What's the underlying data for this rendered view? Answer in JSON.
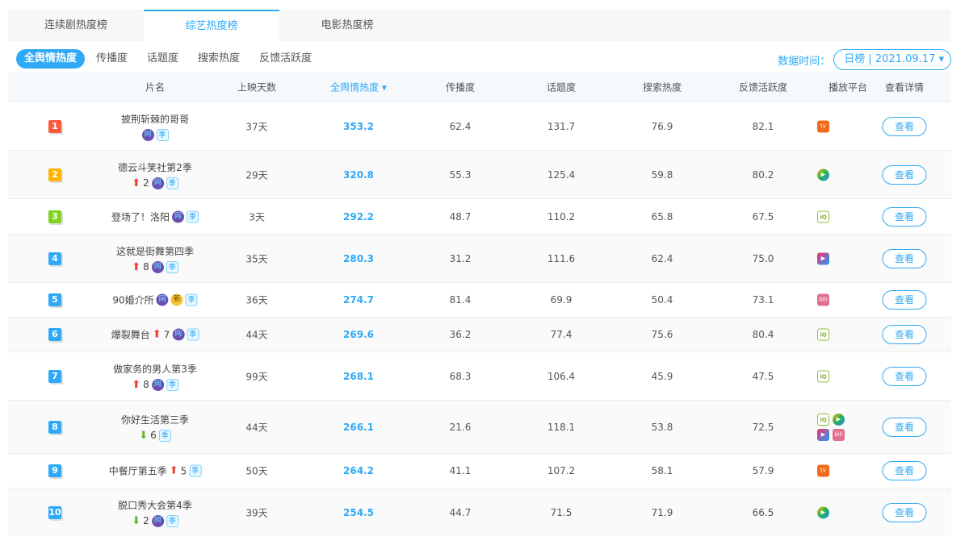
{
  "tabs": [
    "连续剧热度榜",
    "综艺热度榜",
    "电影热度榜"
  ],
  "subtabs": [
    "全舆情热度",
    "传播度",
    "话题度",
    "搜索热度",
    "反馈活跃度"
  ],
  "date_label": "数据时间：",
  "date_value": "日榜 | 2021.09.17 ▾",
  "headers": [
    "片名",
    "上映天数",
    "全舆情热度 ▾",
    "传播度",
    "话题度",
    "搜索热度",
    "反馈活跃度",
    "播放平台",
    "查看详情"
  ],
  "view_label": "查看",
  "rows": [
    {
      "rank": "1",
      "color": "#fa5a3c",
      "name": "披荆斩棘的哥哥",
      "change": "",
      "dir": "",
      "badges": [
        "网",
        "季"
      ],
      "inline": false,
      "days": "37天",
      "heat": "353.2",
      "spread": "62.4",
      "topic": "131.7",
      "search": "76.9",
      "feedback": "82.1",
      "platforms": [
        "mango"
      ],
      "h": 60
    },
    {
      "rank": "2",
      "color": "#ffb400",
      "name": "德云斗笑社第2季",
      "change": "2",
      "dir": "up",
      "badges": [
        "网",
        "季"
      ],
      "inline": false,
      "days": "29天",
      "heat": "320.8",
      "spread": "55.3",
      "topic": "125.4",
      "search": "59.8",
      "feedback": "80.2",
      "platforms": [
        "tencent"
      ],
      "h": 60
    },
    {
      "rank": "3",
      "color": "#7ed321",
      "name": "登场了！洛阳",
      "change": "",
      "dir": "",
      "badges": [
        "网",
        "季"
      ],
      "inline": true,
      "days": "3天",
      "heat": "292.2",
      "spread": "48.7",
      "topic": "110.2",
      "search": "65.8",
      "feedback": "67.5",
      "platforms": [
        "iqiyi"
      ],
      "h": 44
    },
    {
      "rank": "4",
      "color": "#2fa9f5",
      "name": "这就是街舞第四季",
      "change": "8",
      "dir": "up",
      "badges": [
        "网",
        "季"
      ],
      "inline": false,
      "days": "35天",
      "heat": "280.3",
      "spread": "31.2",
      "topic": "111.6",
      "search": "62.4",
      "feedback": "75.0",
      "platforms": [
        "youku"
      ],
      "h": 60
    },
    {
      "rank": "5",
      "color": "#2fa9f5",
      "name": "90婚介所",
      "change": "",
      "dir": "",
      "badges": [
        "网",
        "新",
        "季"
      ],
      "inline": true,
      "days": "36天",
      "heat": "274.7",
      "spread": "81.4",
      "topic": "69.9",
      "search": "50.4",
      "feedback": "73.1",
      "platforms": [
        "bilibili"
      ],
      "h": 43
    },
    {
      "rank": "6",
      "color": "#2fa9f5",
      "name": "爆裂舞台",
      "change": "7",
      "dir": "up",
      "badges": [
        "网",
        "季"
      ],
      "inline": true,
      "days": "44天",
      "heat": "269.6",
      "spread": "36.2",
      "topic": "77.4",
      "search": "75.6",
      "feedback": "80.4",
      "platforms": [
        "iqiyi"
      ],
      "h": 43
    },
    {
      "rank": "7",
      "color": "#2fa9f5",
      "name": "做家务的男人第3季",
      "change": "8",
      "dir": "up",
      "badges": [
        "网",
        "季"
      ],
      "inline": false,
      "days": "99天",
      "heat": "268.1",
      "spread": "68.3",
      "topic": "106.4",
      "search": "45.9",
      "feedback": "47.5",
      "platforms": [
        "iqiyi"
      ],
      "h": 60
    },
    {
      "rank": "8",
      "color": "#2fa9f5",
      "name": "你好生活第三季",
      "change": "6",
      "dir": "down",
      "badges": [
        "季"
      ],
      "inline": false,
      "days": "44天",
      "heat": "266.1",
      "spread": "21.6",
      "topic": "118.1",
      "search": "53.8",
      "feedback": "72.5",
      "platforms": [
        "iqiyi",
        "tencent",
        "youku",
        "bilibili"
      ],
      "h": 66
    },
    {
      "rank": "9",
      "color": "#2fa9f5",
      "name": "中餐厅第五季",
      "change": "5",
      "dir": "up",
      "badges": [
        "季"
      ],
      "inline": true,
      "days": "50天",
      "heat": "264.2",
      "spread": "41.1",
      "topic": "107.2",
      "search": "58.1",
      "feedback": "57.9",
      "platforms": [
        "mango"
      ],
      "h": 43
    },
    {
      "rank": "10",
      "color": "#2fa9f5",
      "name": "脱口秀大会第4季",
      "change": "2",
      "dir": "down",
      "badges": [
        "网",
        "季"
      ],
      "inline": false,
      "days": "39天",
      "heat": "254.5",
      "spread": "44.7",
      "topic": "71.5",
      "search": "71.9",
      "feedback": "66.5",
      "platforms": [
        "tencent"
      ],
      "h": 60
    }
  ]
}
